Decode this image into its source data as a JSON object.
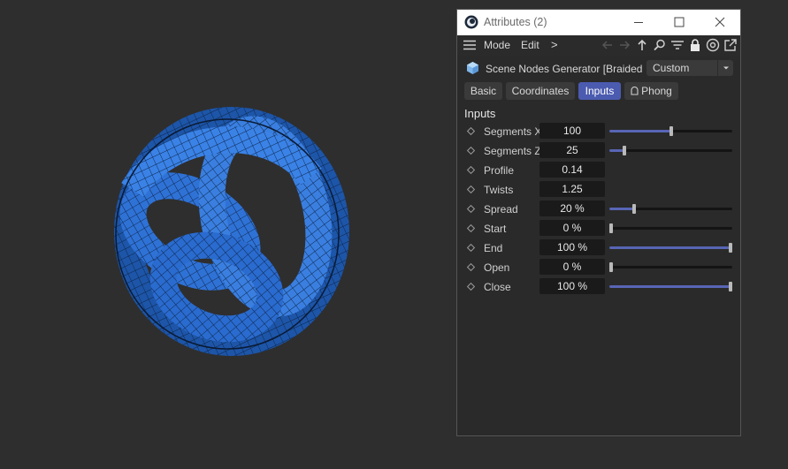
{
  "window": {
    "title": "Attributes (2)",
    "menu": {
      "mode": "Mode",
      "edit": "Edit",
      "more": ">"
    },
    "object_name": "Scene Nodes Generator [Braided Torus]",
    "mode_select": "Custom",
    "tabs": [
      {
        "label": "Basic",
        "active": false
      },
      {
        "label": "Coordinates",
        "active": false
      },
      {
        "label": "Inputs",
        "active": true
      },
      {
        "label": "Phong",
        "active": false
      }
    ],
    "section_title": "Inputs",
    "params": [
      {
        "label": "Segments X",
        "value": "100",
        "slider": 0.5
      },
      {
        "label": "Segments Z",
        "value": "25",
        "slider": 0.12
      },
      {
        "label": "Profile",
        "value": "0.14",
        "slider": null
      },
      {
        "label": "Twists",
        "value": "1.25",
        "slider": null
      },
      {
        "label": "Spread",
        "value": "20 %",
        "slider": 0.2
      },
      {
        "label": "Start",
        "value": "0 %",
        "slider": 0
      },
      {
        "label": "End",
        "value": "100 %",
        "slider": 1
      },
      {
        "label": "Open",
        "value": "0 %",
        "slider": 0
      },
      {
        "label": "Close",
        "value": "100 %",
        "slider": 1
      }
    ]
  },
  "toolbar_icons": [
    "back-arrow-icon",
    "forward-arrow-icon",
    "up-arrow-icon",
    "search-icon",
    "filter-icon",
    "lock-icon",
    "target-icon",
    "new-window-icon"
  ],
  "colors": {
    "accent": "#4b5bb0",
    "mesh": "#2f72d6",
    "background": "#2e2e2e"
  }
}
